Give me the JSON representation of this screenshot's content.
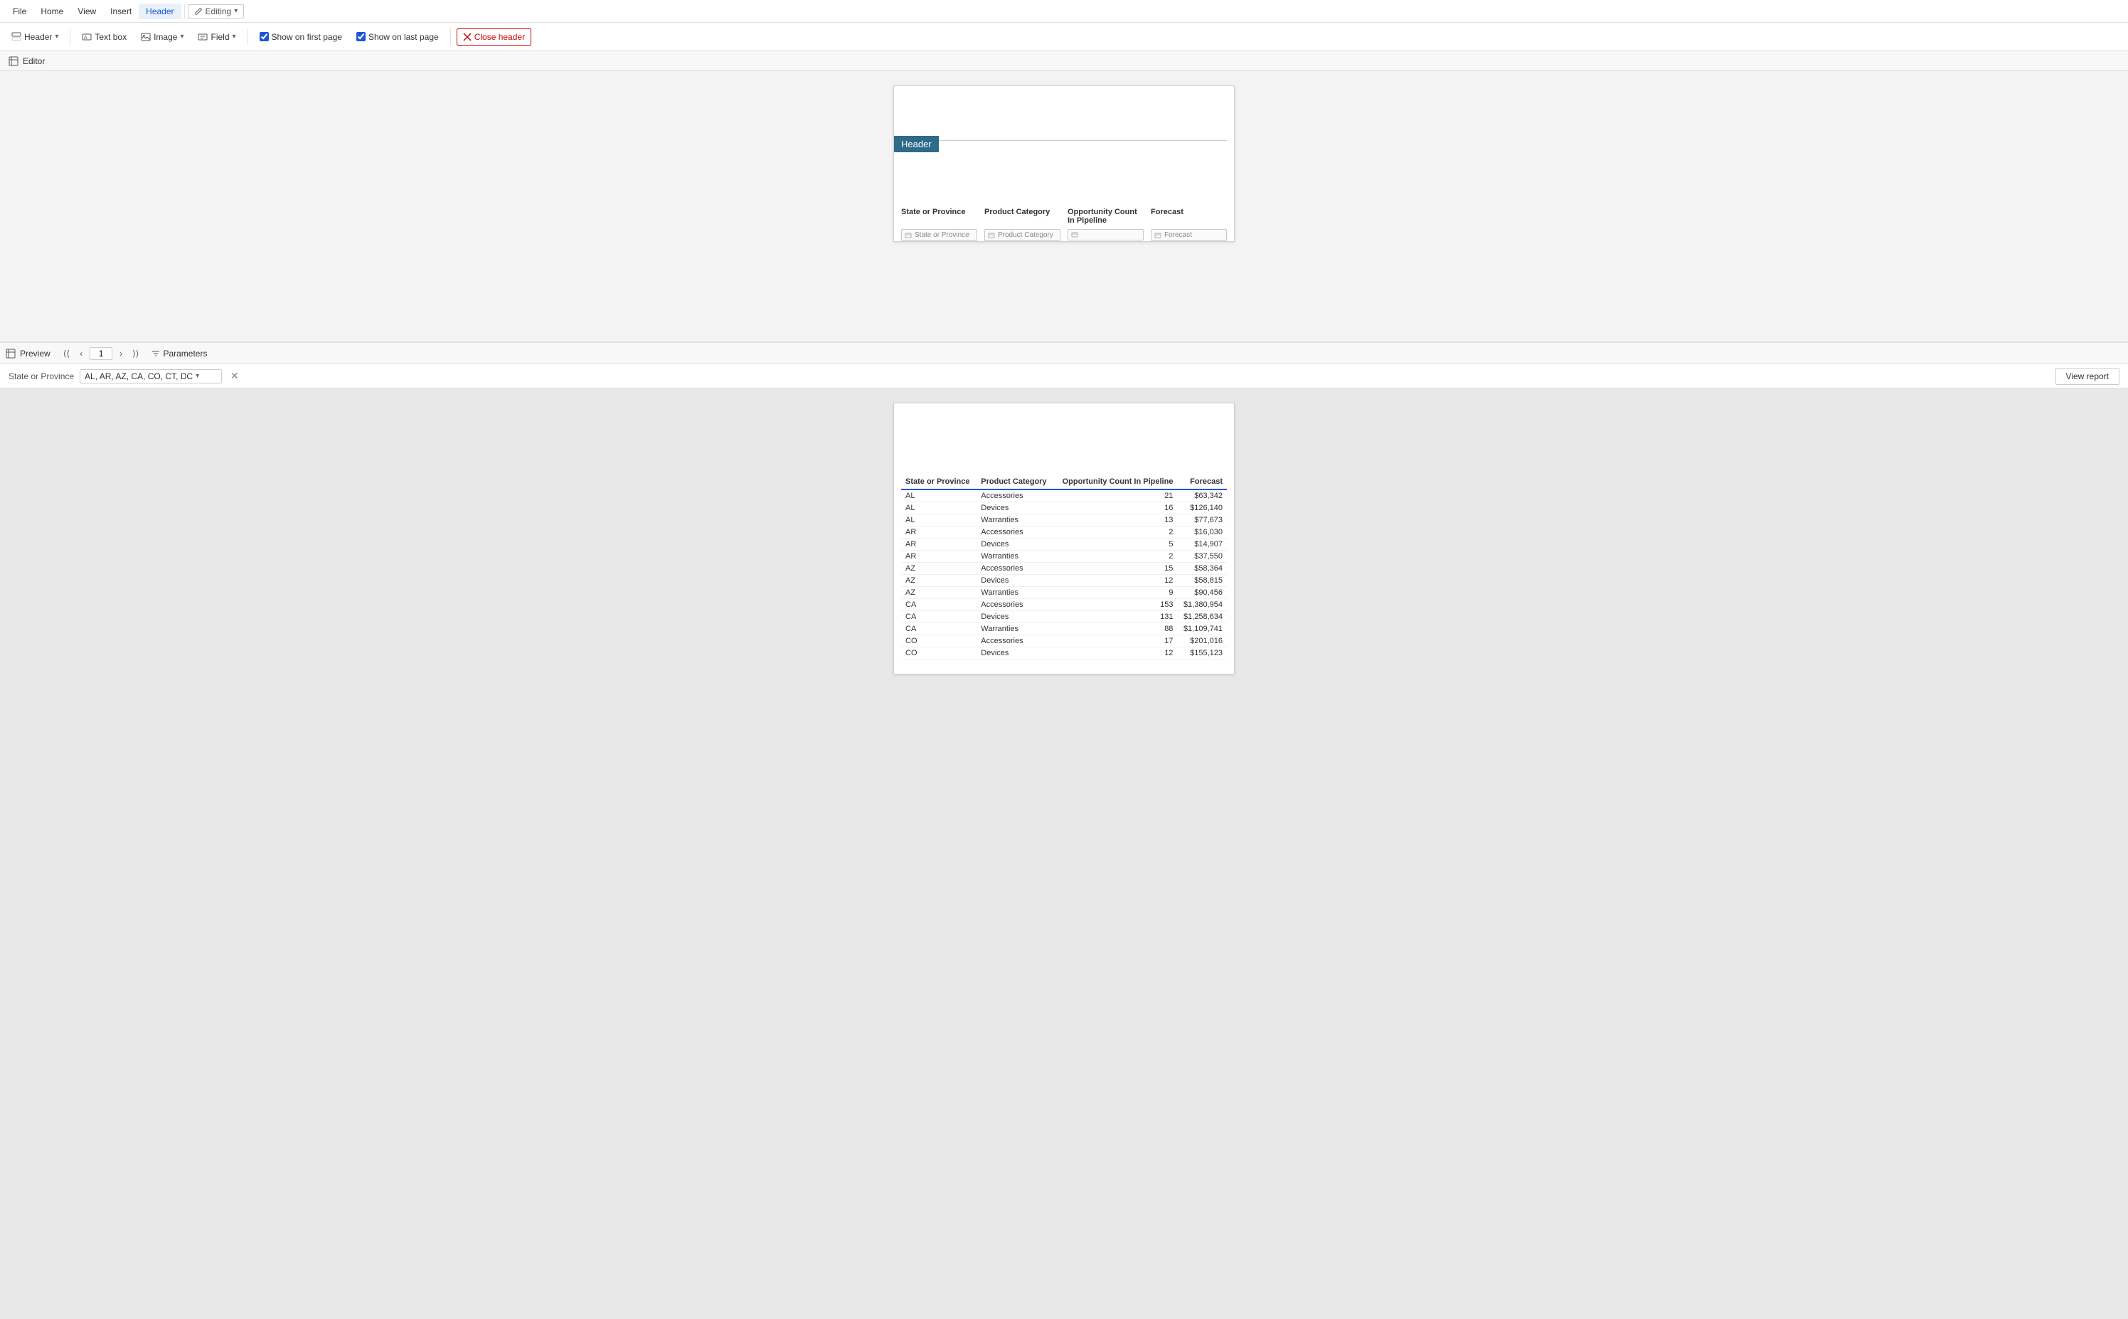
{
  "menu": {
    "items": [
      {
        "id": "file",
        "label": "File",
        "active": false
      },
      {
        "id": "home",
        "label": "Home",
        "active": false
      },
      {
        "id": "view",
        "label": "View",
        "active": false
      },
      {
        "id": "insert",
        "label": "Insert",
        "active": false
      },
      {
        "id": "header",
        "label": "Header",
        "active": true
      }
    ],
    "editing_label": "Editing"
  },
  "toolbar": {
    "header_label": "Header",
    "textbox_label": "Text box",
    "image_label": "Image",
    "field_label": "Field",
    "show_first_label": "Show on first page",
    "show_last_label": "Show on last page",
    "close_header_label": "Close header"
  },
  "editor": {
    "section_label": "Editor",
    "header_band_label": "Header",
    "columns": [
      {
        "id": "state",
        "label": "State or Province",
        "placeholder": "State or Province"
      },
      {
        "id": "product",
        "label": "Product Category",
        "placeholder": "Product Category"
      },
      {
        "id": "opportunity",
        "label": "Opportunity Count In Pipeline",
        "placeholder": ""
      },
      {
        "id": "forecast",
        "label": "Forecast",
        "placeholder": "Forecast"
      }
    ]
  },
  "preview": {
    "section_label": "Preview",
    "page_number": "1",
    "params_label": "Parameters",
    "state_param_label": "State or Province",
    "state_param_value": "AL, AR, AZ, CA, CO, CT, DC",
    "view_report_label": "View report",
    "table": {
      "headers": [
        {
          "id": "state",
          "label": "State or Province",
          "align": "left"
        },
        {
          "id": "product",
          "label": "Product Category",
          "align": "left"
        },
        {
          "id": "opportunity",
          "label": "Opportunity Count In Pipeline",
          "align": "right"
        },
        {
          "id": "forecast",
          "label": "Forecast",
          "align": "right"
        }
      ],
      "rows": [
        {
          "state": "AL",
          "product": "Accessories",
          "opportunity": "21",
          "forecast": "$63,342"
        },
        {
          "state": "AL",
          "product": "Devices",
          "opportunity": "16",
          "forecast": "$126,140"
        },
        {
          "state": "AL",
          "product": "Warranties",
          "opportunity": "13",
          "forecast": "$77,673"
        },
        {
          "state": "AR",
          "product": "Accessories",
          "opportunity": "2",
          "forecast": "$16,030"
        },
        {
          "state": "AR",
          "product": "Devices",
          "opportunity": "5",
          "forecast": "$14,907"
        },
        {
          "state": "AR",
          "product": "Warranties",
          "opportunity": "2",
          "forecast": "$37,550"
        },
        {
          "state": "AZ",
          "product": "Accessories",
          "opportunity": "15",
          "forecast": "$58,364"
        },
        {
          "state": "AZ",
          "product": "Devices",
          "opportunity": "12",
          "forecast": "$58,815"
        },
        {
          "state": "AZ",
          "product": "Warranties",
          "opportunity": "9",
          "forecast": "$90,456"
        },
        {
          "state": "CA",
          "product": "Accessories",
          "opportunity": "153",
          "forecast": "$1,380,954"
        },
        {
          "state": "CA",
          "product": "Devices",
          "opportunity": "131",
          "forecast": "$1,258,634"
        },
        {
          "state": "CA",
          "product": "Warranties",
          "opportunity": "88",
          "forecast": "$1,109,741"
        },
        {
          "state": "CO",
          "product": "Accessories",
          "opportunity": "17",
          "forecast": "$201,016"
        },
        {
          "state": "CO",
          "product": "Devices",
          "opportunity": "12",
          "forecast": "$155,123"
        }
      ]
    }
  },
  "colors": {
    "header_active": "#1a56db",
    "header_band_bg": "#2e6b8a",
    "table_header_border": "#1a56db"
  }
}
